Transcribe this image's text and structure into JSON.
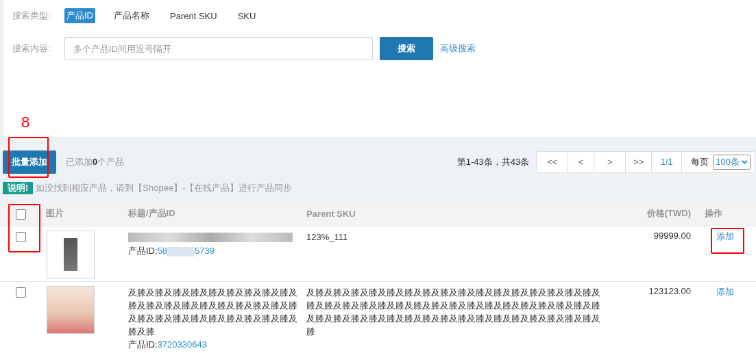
{
  "search_type": {
    "label": "搜索类型:",
    "options": [
      {
        "label": "产品ID",
        "selected": true
      },
      {
        "label": "产品名称",
        "selected": false
      },
      {
        "label": "Parent SKU",
        "selected": false
      },
      {
        "label": "SKU",
        "selected": false
      }
    ]
  },
  "search_content": {
    "label": "搜索内容:",
    "placeholder": "多个产品ID间用逗号隔开",
    "button": "搜索",
    "advanced_link": "高级搜索"
  },
  "annotation": {
    "label": "8"
  },
  "toolbar": {
    "bulk_add_button": "批量添加",
    "added_prefix": "已添加",
    "added_count": "0",
    "added_suffix": "个产品",
    "range_text": "第1-43条，共43条",
    "pager": [
      "<<",
      "<",
      ">",
      ">>"
    ],
    "page": "1/1",
    "per_page_label": "每页",
    "per_page_value": "100条"
  },
  "notice": {
    "badge": "说明!",
    "text": "如没找到相应产品，请到【Shopee】-【在线产品】进行产品同步"
  },
  "table": {
    "select_all_checked": false,
    "columns": [
      "图片",
      "标题/产品ID",
      "Parent SKU",
      "价格(TWD)",
      "操作"
    ],
    "rows": [
      {
        "checked": false,
        "title_redacted": true,
        "id_label": "产品ID:",
        "id_start": "58",
        "id_redacted": true,
        "id_end": "5739",
        "parent_sku": "123%_111",
        "price": "99999.00",
        "action": "添加"
      },
      {
        "checked": false,
        "title_redacted": false,
        "title": "及膝及膝及膝及膝及膝及膝及膝及膝及膝及膝及膝及膝及膝及膝及膝及膝及膝及膝及膝及膝及膝及膝及膝及膝及膝及膝及膝及膝及膝及膝",
        "id_label": "产品ID:",
        "id_start": "3720330643",
        "id_redacted": false,
        "parent_sku": "及膝及膝及膝及膝及膝及膝及膝及膝及膝及膝及膝及膝及膝及膝及膝及膝及膝及膝及膝及膝及膝及膝及膝及膝及膝及膝及膝及膝及膝及膝及膝及膝及膝及膝及膝及膝及膝及膝及膝及膝及膝及膝及膝及膝及膝及膝及膝及膝及膝及膝",
        "price": "123123.00",
        "action": "添加"
      }
    ]
  }
}
